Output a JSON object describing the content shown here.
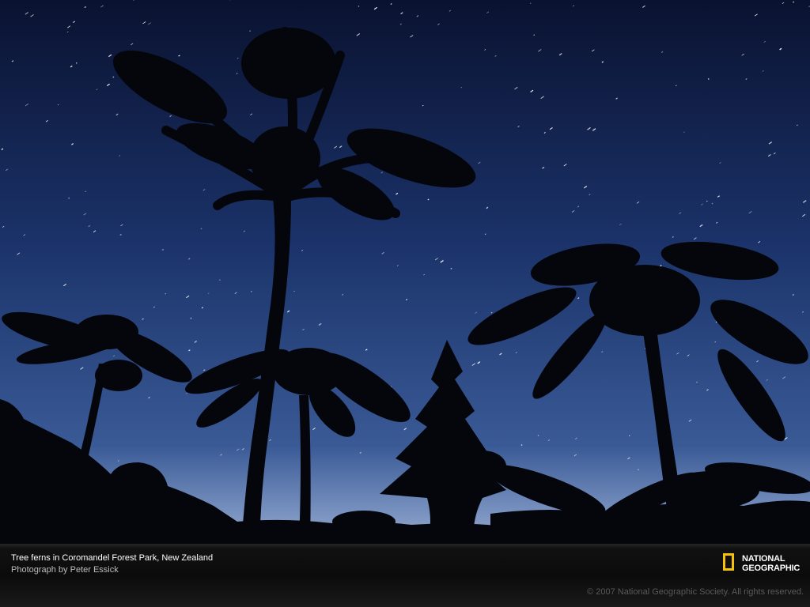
{
  "caption": {
    "title": "Tree ferns in Coromandel Forest Park, New Zealand",
    "credit": "Photograph by Peter Essick"
  },
  "copyright": "© 2007 National Geographic Society. All rights reserved.",
  "logo": {
    "line1": "NATIONAL",
    "line2": "GEOGRAPHIC",
    "frame_color": "#f4c20d"
  },
  "colors": {
    "sky_top": "#0b1430",
    "sky_mid": "#1f3a72",
    "horizon": "#6f8fc4",
    "horizon_glow": "#f2d27a",
    "silhouette": "#06070d"
  }
}
